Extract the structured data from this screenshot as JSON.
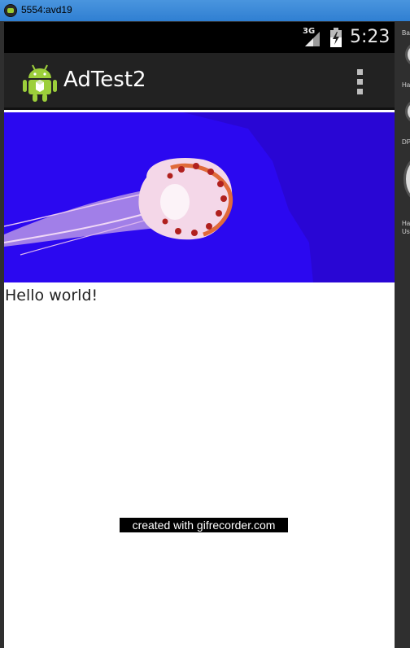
{
  "window": {
    "title": "5554:avd19"
  },
  "status_bar": {
    "network": "3G",
    "time": "5:23"
  },
  "action_bar": {
    "title": "AdTest2"
  },
  "content": {
    "hello_text": "Hello world!"
  },
  "watermark": {
    "text": "created with gifrecorder.com"
  },
  "side_panel": {
    "labels": [
      "Ba",
      "Ha",
      "DP",
      "Ha",
      "Us"
    ]
  },
  "icons": {
    "app_icon": "android-robot-icon",
    "overflow": "overflow-menu-icon",
    "signal": "cell-signal-icon",
    "battery": "battery-charging-icon"
  },
  "colors": {
    "status_bar": "#000000",
    "action_bar": "#222222",
    "banner_background": "#2b08f0",
    "window_titlebar": "#3a88d8"
  }
}
